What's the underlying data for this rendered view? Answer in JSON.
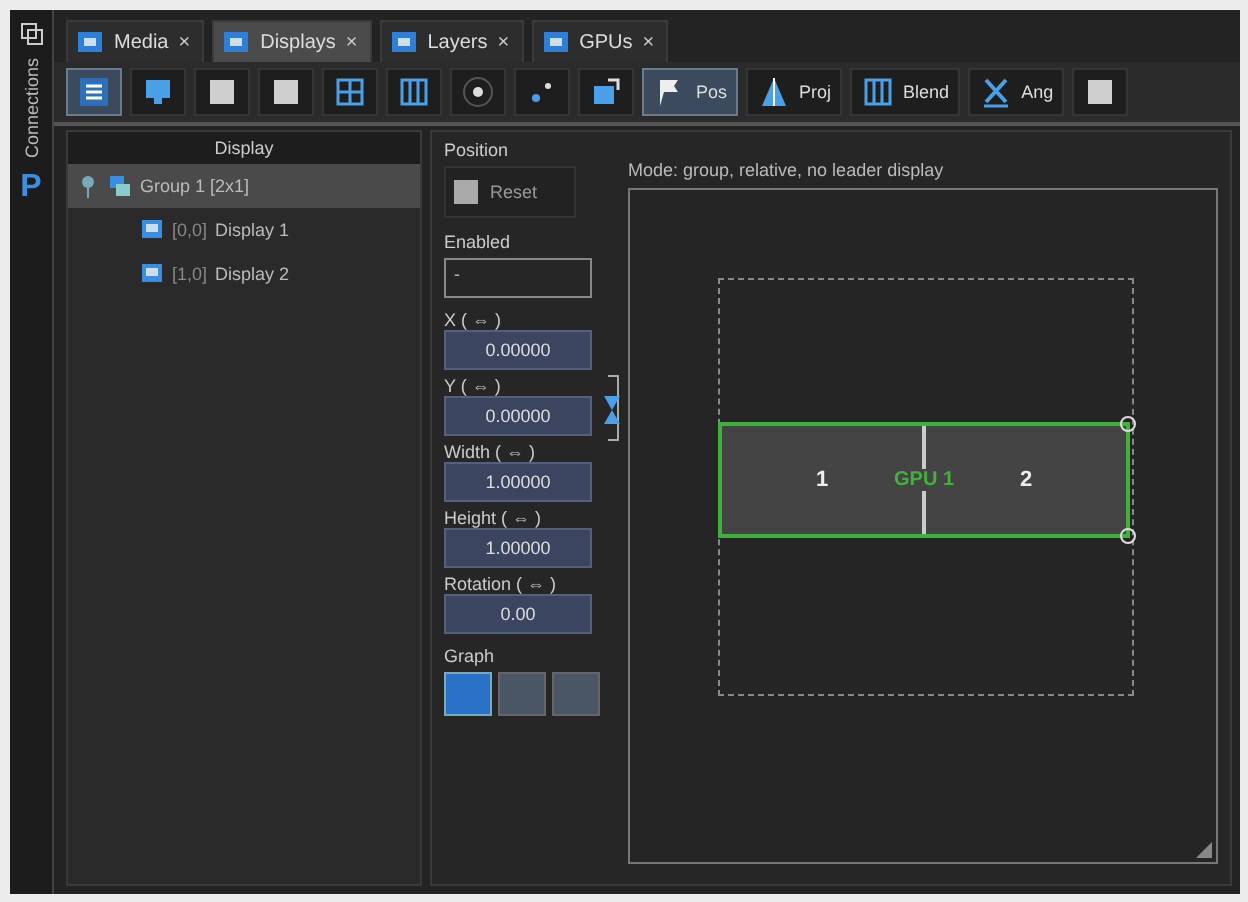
{
  "sidebar": {
    "label": "Connections",
    "logo": "P"
  },
  "tabs": [
    {
      "label": "Media",
      "selected": false,
      "close": "×"
    },
    {
      "label": "Displays",
      "selected": true,
      "close": "×"
    },
    {
      "label": "Layers",
      "selected": false,
      "close": "×"
    },
    {
      "label": "GPUs",
      "selected": false,
      "close": "×"
    }
  ],
  "toolbar": [
    {
      "kind": "list",
      "selected": true
    },
    {
      "kind": "monitor",
      "selected": false
    },
    {
      "kind": "square",
      "selected": false
    },
    {
      "kind": "square",
      "selected": false
    },
    {
      "kind": "grid",
      "selected": false
    },
    {
      "kind": "columns",
      "selected": false
    },
    {
      "kind": "dot",
      "selected": false
    },
    {
      "kind": "dots",
      "selected": false
    },
    {
      "kind": "move",
      "selected": false
    },
    {
      "kind": "flag",
      "label": "Pos",
      "selected": true
    },
    {
      "kind": "pyramid",
      "label": "Proj",
      "selected": false
    },
    {
      "kind": "columns",
      "label": "Blend",
      "selected": false
    },
    {
      "kind": "angle",
      "label": "Ang",
      "selected": false
    },
    {
      "kind": "square",
      "selected": false
    }
  ],
  "tree": {
    "header": "Display",
    "items": [
      {
        "label": "Group 1 [2x1]",
        "selected": true,
        "expanded": true,
        "children": [
          {
            "tag": "[0,0]",
            "label": "Display 1",
            "selected": false
          },
          {
            "tag": "[1,0]",
            "label": "Display 2",
            "selected": false
          }
        ]
      }
    ]
  },
  "properties": {
    "title": "Position",
    "reset": {
      "label": "Reset",
      "disabled": true
    },
    "enabled": {
      "label": "Enabled",
      "value": "-"
    },
    "fields": [
      {
        "label": "X ( ⇔ )",
        "value": "0.00000"
      },
      {
        "label": "Y ( ⇔ )",
        "value": "0.00000"
      },
      {
        "label": "Width ( ⇔ )",
        "value": "1.00000"
      },
      {
        "label": "Height ( ⇔ )",
        "value": "1.00000"
      },
      {
        "label": "Rotation ( ⇔ )",
        "value": "0.00"
      }
    ],
    "graph": {
      "label": "Graph",
      "buttons": [
        {
          "selected": true
        },
        {
          "selected": false
        },
        {
          "selected": false
        }
      ]
    }
  },
  "canvas": {
    "caption": "Mode: group, relative, no leader display",
    "group_label": "GPU 1",
    "displays": [
      {
        "label": "1"
      },
      {
        "label": "2"
      }
    ]
  }
}
